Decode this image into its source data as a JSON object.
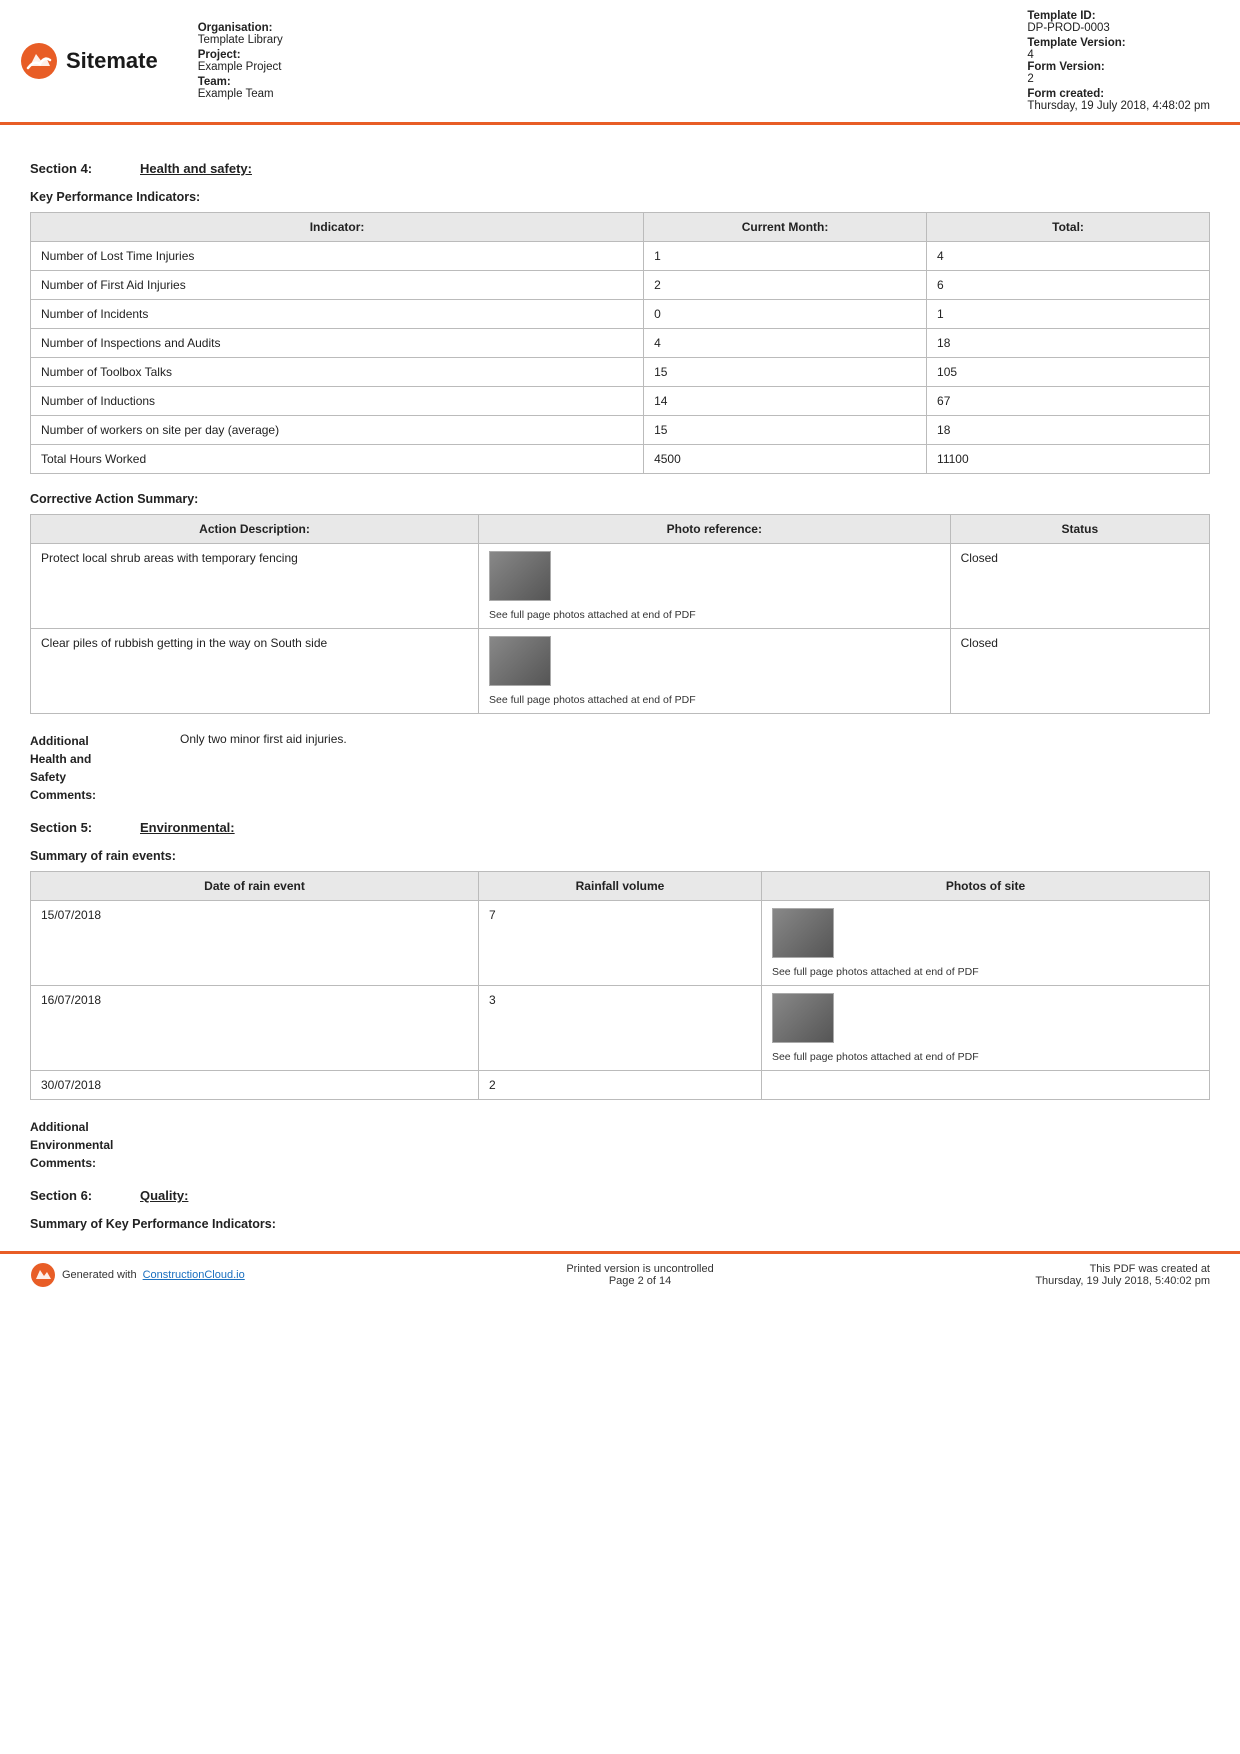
{
  "header": {
    "logo_text": "Sitemate",
    "organisation_label": "Organisation:",
    "organisation_value": "Template Library",
    "project_label": "Project:",
    "project_value": "Example Project",
    "team_label": "Team:",
    "team_value": "Example Team",
    "template_id_label": "Template ID:",
    "template_id_value": "DP-PROD-0003",
    "template_version_label": "Template Version:",
    "template_version_value": "4",
    "form_version_label": "Form Version:",
    "form_version_value": "2",
    "form_created_label": "Form created:",
    "form_created_value": "Thursday, 19 July 2018, 4:48:02 pm"
  },
  "section4": {
    "label": "Section 4:",
    "title": "Health and safety:"
  },
  "kpi": {
    "heading": "Key Performance Indicators:",
    "columns": [
      "Indicator:",
      "Current Month:",
      "Total:"
    ],
    "rows": [
      {
        "indicator": "Number of Lost Time Injuries",
        "current": "1",
        "total": "4"
      },
      {
        "indicator": "Number of First Aid Injuries",
        "current": "2",
        "total": "6"
      },
      {
        "indicator": "Number of Incidents",
        "current": "0",
        "total": "1"
      },
      {
        "indicator": "Number of Inspections and Audits",
        "current": "4",
        "total": "18"
      },
      {
        "indicator": "Number of Toolbox Talks",
        "current": "15",
        "total": "105"
      },
      {
        "indicator": "Number of Inductions",
        "current": "14",
        "total": "67"
      },
      {
        "indicator": "Number of workers on site per day (average)",
        "current": "15",
        "total": "18"
      },
      {
        "indicator": "Total Hours Worked",
        "current": "4500",
        "total": "11100"
      }
    ]
  },
  "corrective": {
    "heading": "Corrective Action Summary:",
    "columns": [
      "Action Description:",
      "Photo reference:",
      "Status"
    ],
    "rows": [
      {
        "action": "Protect local shrub areas with temporary fencing",
        "photo_caption": "See full page photos attached at end of PDF",
        "status": "Closed"
      },
      {
        "action": "Clear piles of rubbish getting in the way on South side",
        "photo_caption": "See full page photos attached at end of PDF",
        "status": "Closed"
      }
    ]
  },
  "additional_hs": {
    "label": "Additional\nHealth and\nSafety\nComments:",
    "value": "Only two minor first aid injuries."
  },
  "section5": {
    "label": "Section 5:",
    "title": "Environmental:"
  },
  "rain": {
    "heading": "Summary of rain events:",
    "columns": [
      "Date of rain event",
      "Rainfall volume",
      "Photos of site"
    ],
    "rows": [
      {
        "date": "15/07/2018",
        "volume": "7",
        "photo_caption": "See full page photos attached at end of PDF"
      },
      {
        "date": "16/07/2018",
        "volume": "3",
        "photo_caption": "See full page photos attached at end of PDF"
      },
      {
        "date": "30/07/2018",
        "volume": "2",
        "photo_caption": ""
      }
    ]
  },
  "additional_env": {
    "label": "Additional\nEnvironmental\nComments:",
    "value": ""
  },
  "section6": {
    "label": "Section 6:",
    "title": "Quality:"
  },
  "summary_kpi": {
    "heading": "Summary of Key Performance Indicators:"
  },
  "footer": {
    "generated_text": "Generated with",
    "link_text": "ConstructionCloud.io",
    "uncontrolled_text": "Printed version is uncontrolled",
    "page_text": "Page 2 of 14",
    "pdf_created_label": "This PDF was created at",
    "pdf_created_value": "Thursday, 19 July 2018, 5:40:02 pm"
  }
}
